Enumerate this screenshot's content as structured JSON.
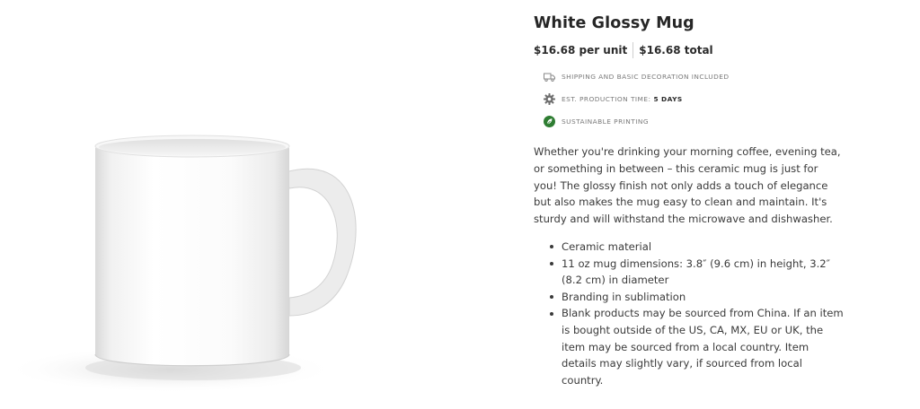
{
  "product": {
    "title": "White Glossy Mug",
    "price_unit": "$16.68 per unit",
    "price_total": "$16.68 total"
  },
  "features": [
    {
      "icon": "truck-icon",
      "text": "Shipping and basic decoration included",
      "strong": ""
    },
    {
      "icon": "gear-icon",
      "text": "Est. production time:",
      "strong": "5 days"
    },
    {
      "icon": "leaf-icon",
      "text": "Sustainable printing",
      "strong": "",
      "color": "#2e7d32"
    }
  ],
  "description": "Whether you're drinking your morning coffee, evening tea, or something in between – this ceramic mug is just for you! The glossy finish not only adds a touch of elegance but also makes the mug easy to clean and maintain. It's sturdy and will withstand the microwave and dishwasher.",
  "bullets": [
    "Ceramic material",
    "11 oz mug dimensions: 3.8″ (9.6 cm) in height, 3.2″ (8.2 cm) in diameter",
    "Branding in sublimation",
    "Blank products may be sourced from China. If an item is bought outside of the US, CA, MX, EU or UK, the item may be sourced from a local country. Item details may slightly vary, if sourced from local country."
  ],
  "colors": {
    "text": "#2b2b2b",
    "muted": "#7a7a7a",
    "leaf_green": "#2e7d32"
  }
}
